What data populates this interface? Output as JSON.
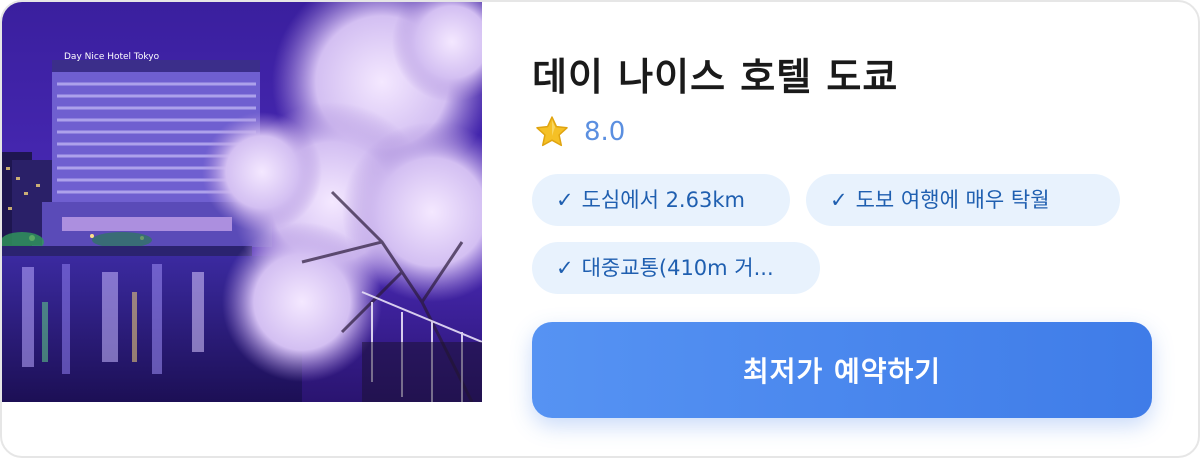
{
  "hotel": {
    "name": "데이 나이스 호텔 도쿄",
    "photo_sign_text": "Day Nice Hotel Tokyo",
    "rating": "8.0",
    "rating_icon": "star-icon"
  },
  "features": [
    {
      "check": "✓",
      "label": "도심에서 2.63km"
    },
    {
      "check": "✓",
      "label": "도보 여행에 매우 탁월"
    },
    {
      "check": "✓",
      "label": "대중교통(410m 거..."
    }
  ],
  "actions": {
    "book_label": "최저가 예약하기"
  },
  "colors": {
    "button_start": "#5693f3",
    "button_end": "#3f7ce8",
    "chip_background": "#e8f2fd",
    "chip_text": "#1f5fb0",
    "rating_text": "#5b8fe0",
    "star": "#f5c025"
  }
}
